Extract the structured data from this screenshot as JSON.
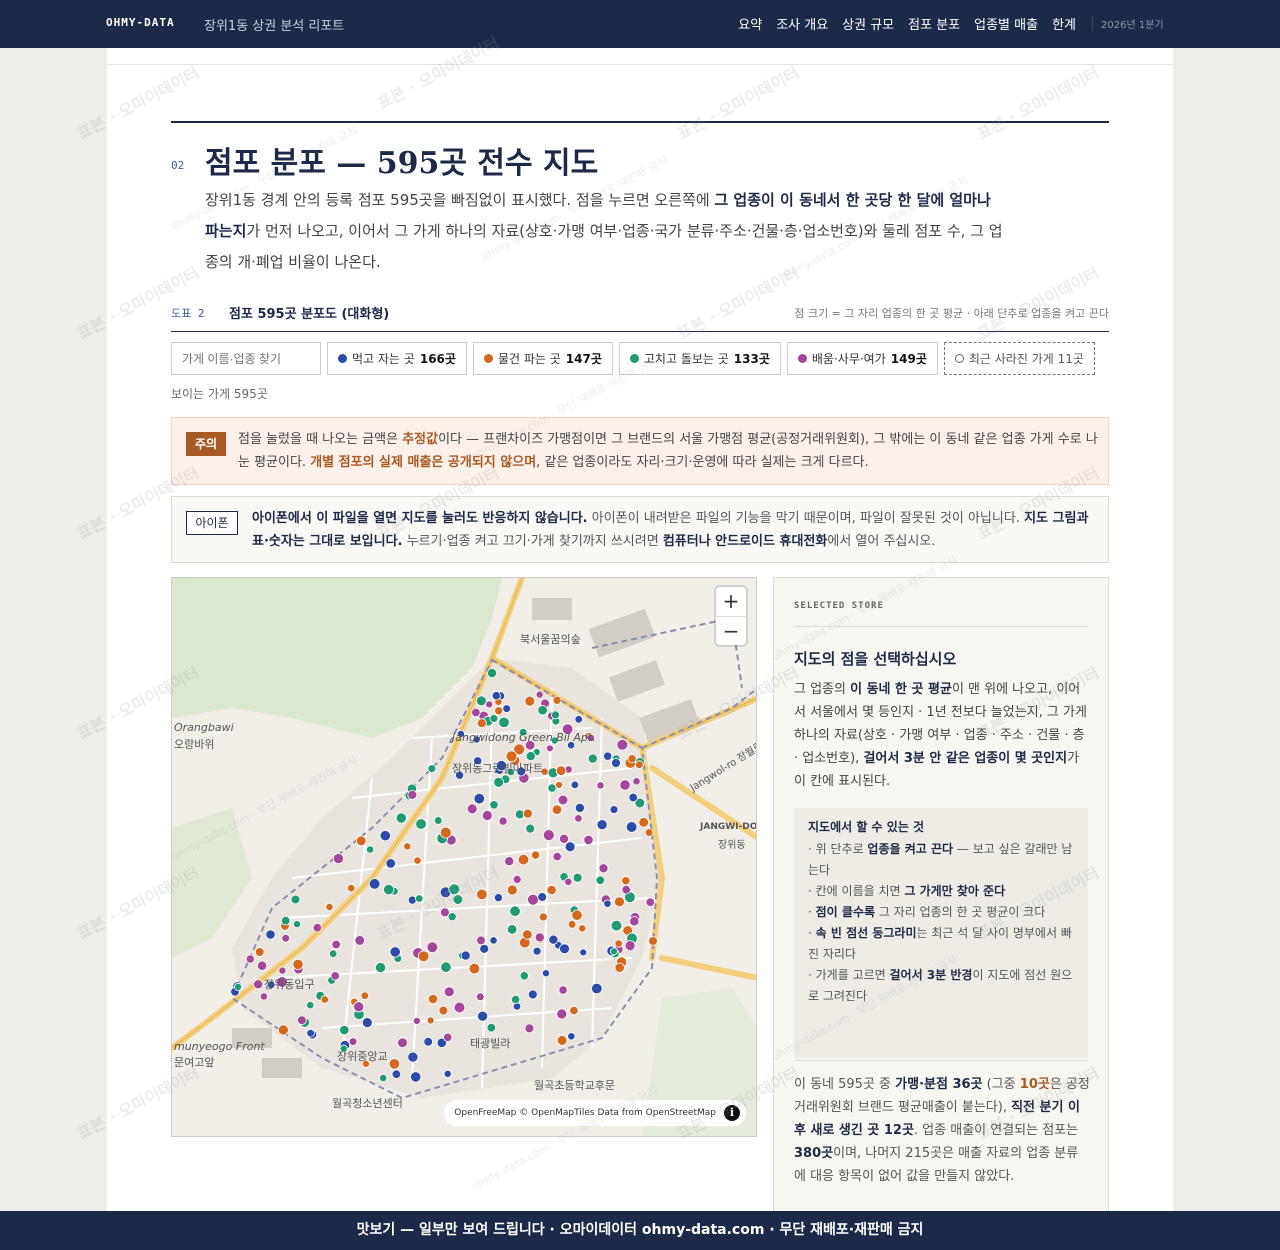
{
  "header": {
    "brand": "OHMY-DATA",
    "subtitle": "장위1동 상권 분석 리포트",
    "nav": [
      "요약",
      "조사 개요",
      "상권 규모",
      "점포 분포",
      "업종별 매출",
      "한계"
    ],
    "period": "2026년 1분기"
  },
  "section": {
    "number": "02",
    "title": "점포 분포 — 595곳 전수 지도",
    "desc_1": "장위1동 경계 안의 등록 점포 595곳을 빠짐없이 표시했다. 점을 누르면 오른쪽에 ",
    "desc_bold": "그 업종이 이 동네서 한 곳당 한 달에 얼마나 파는지",
    "desc_2": "가 먼저 나오고, 이어서 그 가게 하나의 자료(상호·가맹 여부·업종·국가 분류·주소·건물·층·업소번호)와 둘레 점포 수, 그 업종의 개·폐업 비율이 나온다."
  },
  "figure": {
    "label": "도표 2",
    "title": "점포 595곳 분포도 (대화형)",
    "note": "점 크기 = 그 자리 업종의 한 곳 평균 · 아래 단추로 업종을 켜고 끈다"
  },
  "filters": {
    "search_placeholder": "가게 이름·업종 찾기",
    "chips": [
      {
        "label": "먹고 자는 곳",
        "count": "166곳",
        "color": "#2b4ba8"
      },
      {
        "label": "물건 파는 곳",
        "count": "147곳",
        "color": "#d4691e"
      },
      {
        "label": "고치고 돌보는 곳",
        "count": "133곳",
        "color": "#1f9a72"
      },
      {
        "label": "배움·사무·여가",
        "count": "149곳",
        "color": "#a4479a"
      }
    ],
    "closed_chip": "최근 사라진 가게 11곳",
    "visible_count": "보이는 가게 595곳"
  },
  "caution": {
    "tag": "주의",
    "t1": "점을 눌렀을 때 나오는 금액은 ",
    "b1": "추정값",
    "t2": "이다 — 프랜차이즈 가맹점이면 그 브랜드의 서울 가맹점 평균(공정거래위원회), 그 밖에는 이 동네 같은 업종 가게 수로 나눈 평균이다. ",
    "b2": "개별 점포의 실제 매출은 공개되지 않으며",
    "t3": ", 같은 업종이라도 자리·크기·운영에 따라 실제는 크게 다르다."
  },
  "ios": {
    "tag": "아이폰",
    "b1": "아이폰에서 이 파일을 열면 지도를 눌러도 반응하지 않습니다.",
    "t1": " 아이폰이 내려받은 파일의 기능을 막기 때문이며, 파일이 잘못된 것이 아닙니다. ",
    "b2": "지도 그림과 표·숫자는 그대로 보입니다.",
    "t2": " 누르기·업종 켜고 끄기·가게 찾기까지 쓰시려면 ",
    "b3": "컴퓨터나 안드로이드 휴대전화",
    "t3": "에서 열어 주십시오."
  },
  "map": {
    "zoom_in": "+",
    "zoom_out": "−",
    "attribution": "OpenFreeMap © OpenMapTiles Data from OpenStreetMap",
    "labels": {
      "clinic": "북서울꿈의숲",
      "apt_en": "Jangwidong Green Bil Apt.",
      "apt_ko": "장위동그린빌아파트",
      "jangwi_do": "JANGWI-DO",
      "jangwi_dong": "장위동",
      "road": "Jangwol-ro 장월로",
      "stop1": "장위동입구",
      "stop2": "장위중앙교",
      "villa": "태광빌라",
      "school": "월곡초등학교후문",
      "youth": "월곡청소년센터",
      "orangbawi": "Orangbawi",
      "orangbawi_ko": "오랑바위",
      "munyeo_en": "munyeogo Front",
      "munyeo_ko": "문여고앞"
    }
  },
  "panel": {
    "eyebrow": "SELECTED STORE",
    "title": "지도의 점을 선택하십시오",
    "d1": "그 업종의 ",
    "db1": "이 동네 한 곳 평균",
    "d2": "이 맨 위에 나오고, 이어서 서울에서 몇 등인지 · 1년 전보다 늘었는지, 그 가게 하나의 자료(상호 · 가맹 여부 · 업종 · 주소 · 건물 · 층 · 업소번호), ",
    "db2": "걸어서 3분 안 같은 업종이 몇 곳인지",
    "d3": "가 이 칸에 표시된다.",
    "howto_title": "지도에서 할 수 있는 것",
    "howto": [
      {
        "pre": "· 위 단추로 ",
        "b": "업종을 켜고 끈다",
        "post": " — 보고 싶은 갈래만 남는다"
      },
      {
        "pre": "· 칸에 이름을 치면 ",
        "b": "그 가게만 찾아 준다",
        "post": ""
      },
      {
        "pre": "· ",
        "b": "점이 클수록",
        "post": " 그 자리 업종의 한 곳 평균이 크다"
      },
      {
        "pre": "· ",
        "b": "속 빈 점선 동그라미",
        "post": "는 최근 석 달 사이 명부에서 빠진 자리다"
      },
      {
        "pre": "· 가게를 고르면 ",
        "b": "걸어서 3분 반경",
        "post": "이 지도에 점선 원으로 그려진다"
      }
    ],
    "s1": "이 동네 595곳 중 ",
    "sb1": "가맹·분점 36곳",
    "s2": " (그중 ",
    "sb2": "10곳",
    "s3": "은 공정거래위원회 브랜드 평균매출이 붙는다), ",
    "sb3": "직전 분기 이후 새로 생긴 곳 12곳",
    "s4": ". 업종 매출이 연결되는 점포는 ",
    "sb4": "380곳",
    "s5": "이며, 나머지 215곳은 매출 자료의 업종 분류에 대응 항목이 없어 값을 만들지 않았다."
  },
  "footer": "맛보기 — 일부만 보여 드립니다 · 오마이데이터 ohmy-data.com · 무단 재배포·재판매 금지",
  "watermark": {
    "main": "표본 · 오마이데이터",
    "sub": "ohmy-data.com · 무단 재배포·재판매 금지"
  },
  "colors": {
    "navy": "#1d2a47",
    "food": "#2b4ba8",
    "retail": "#d4691e",
    "service": "#1f9a72",
    "office": "#a4479a",
    "accent": "#a85a25"
  }
}
